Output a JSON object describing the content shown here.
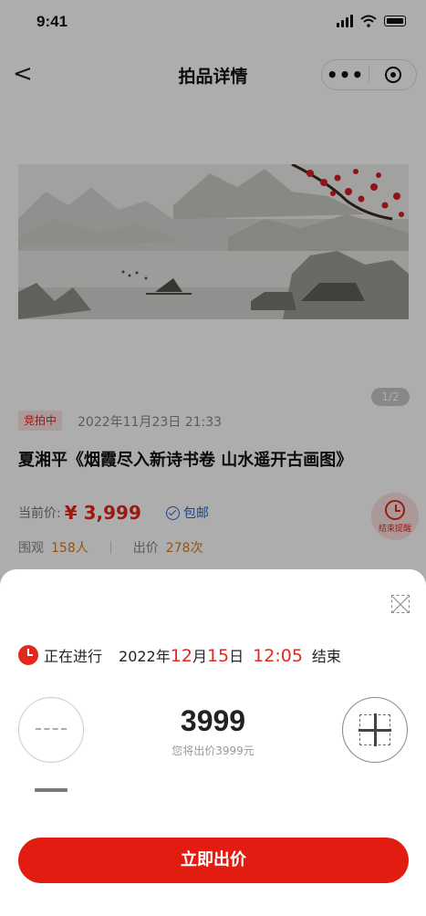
{
  "status_bar": {
    "time": "9:41"
  },
  "nav": {
    "back": "<",
    "title": "拍品详情",
    "more": "•••"
  },
  "banner": {
    "pager": "1/2"
  },
  "item": {
    "status_tag": "竞拍中",
    "start_time": "2022年11月23日 21:33",
    "title": "夏湘平《烟霞尽入新诗书卷 山水遥开古画图》",
    "price_label": "当前价:",
    "price_value": "¥ 3,999",
    "free_shipping": "包邮",
    "views_label": "围观",
    "views_value": "158人",
    "bids_label": "出价",
    "bids_value": "278次",
    "remind_label": "结束提醒"
  },
  "sheet": {
    "status": "正在进行",
    "end_year": "2022年",
    "end_month": "12",
    "end_month_unit": "月",
    "end_day": "15",
    "end_day_unit": "日",
    "end_clock": "12:05",
    "end_suffix": "结束",
    "bid_amount": "3999",
    "bid_hint": "您将出价3999元",
    "bid_button": "立即出价"
  },
  "colors": {
    "accent": "#e31c12",
    "link_blue": "#2a68c8",
    "orange": "#e07a1e"
  },
  "icons": [
    "back-icon",
    "more-icon",
    "close-circle-icon",
    "check-circle-icon",
    "alarm-clock-icon",
    "close-icon",
    "clock-icon",
    "minus-icon",
    "plus-icon"
  ]
}
